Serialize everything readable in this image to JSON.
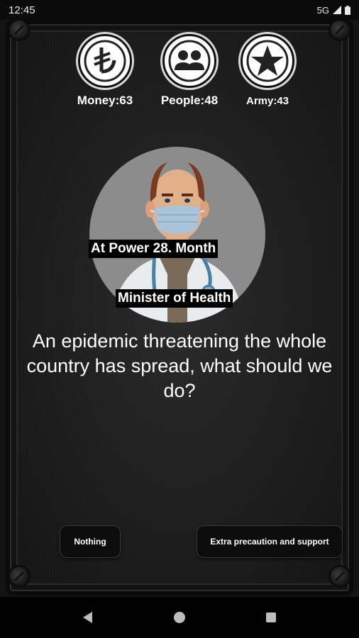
{
  "status_bar": {
    "time": "12:45",
    "network": "5G"
  },
  "stats": [
    {
      "icon": "lira-icon",
      "label": "Money:63",
      "value": 63
    },
    {
      "icon": "people-icon",
      "label": "People:48",
      "value": 48
    },
    {
      "icon": "star-icon",
      "label": "Army:43",
      "value": 43
    }
  ],
  "character": {
    "tenure": "At Power 28. Month",
    "role": "Minister of Health"
  },
  "question": "An epidemic threatening the whole country has spread, what should we do?",
  "choices": {
    "left": "Nothing",
    "right": "Extra precaution and support"
  },
  "colors": {
    "background": "#1d1d1d",
    "stat_icon_bg": "#ffffff",
    "button_bg": "#0c0c0c"
  }
}
